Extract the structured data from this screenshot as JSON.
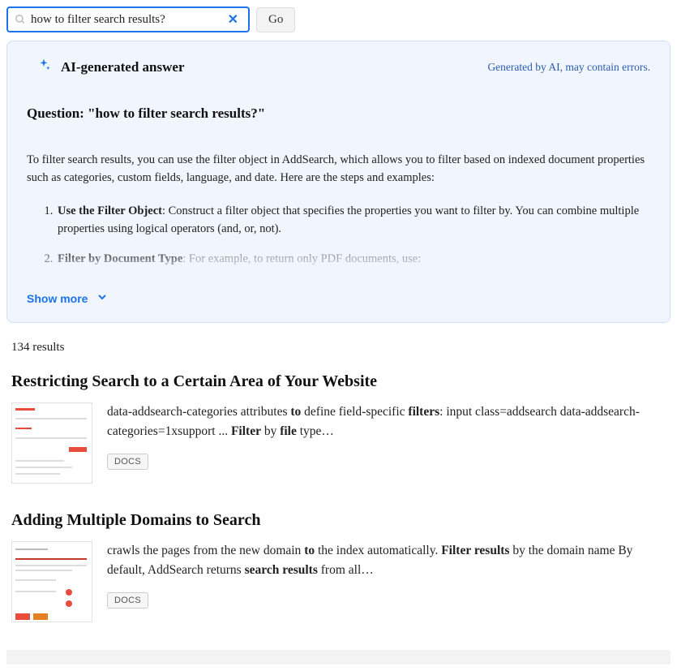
{
  "search": {
    "value": "how to filter search results?",
    "placeholder": "",
    "go_label": "Go"
  },
  "ai": {
    "title": "AI-generated answer",
    "disclaimer": "Generated by AI, may contain errors.",
    "question_prefix": "Question: \"",
    "question_text": "how to filter search results?",
    "question_suffix": "\"",
    "intro": "To filter search results, you can use the filter object in AddSearch, which allows you to filter based on indexed document properties such as categories, custom fields, language, and date. Here are the steps and examples:",
    "items": [
      {
        "bold": "Use the Filter Object",
        "rest": ": Construct a filter object that specifies the properties you want to filter by. You can combine multiple properties using logical operators (and, or, not)."
      },
      {
        "bold": "Filter by Document Type",
        "rest_faded": ": For example, to return only PDF documents, use:"
      }
    ],
    "show_more": "Show more"
  },
  "results": {
    "count_text": "134 results",
    "items": [
      {
        "title": "Restricting Search to a Certain Area of Your Website",
        "snippet_parts": [
          "data-addsearch-categories attributes ",
          "to",
          " define field-specific ",
          "filters",
          ": input class=addsearch data-addsearch-categories=1xsupport ... ",
          "Filter",
          " by ",
          "file",
          " type…"
        ],
        "snippet_bold_idx": [
          1,
          3,
          5,
          7
        ],
        "tag": "DOCS"
      },
      {
        "title": "Adding Multiple Domains to Search",
        "snippet_parts": [
          "crawls the pages from the new domain ",
          "to",
          " the index automatically. ",
          "Filter results",
          " by the domain name By default, AddSearch returns ",
          "search results",
          " from all…"
        ],
        "snippet_bold_idx": [
          1,
          3,
          5
        ],
        "tag": "DOCS"
      }
    ]
  }
}
